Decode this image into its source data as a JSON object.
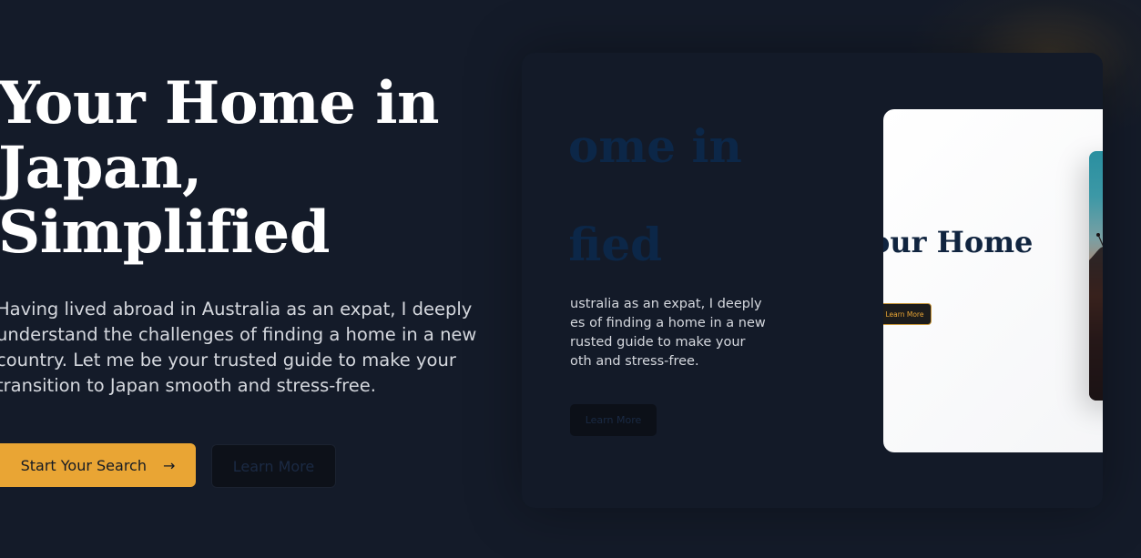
{
  "hero": {
    "title_line1": "Your Home in",
    "title_line2": "Japan,",
    "title_line3": "Simplified",
    "description": "Having lived abroad in Australia as an expat, I deeply understand the challenges of finding a home in a new country. Let me be your trusted guide to make your transition to Japan smooth and stress-free.",
    "primary_button": "Start Your Search",
    "primary_icon": "arrow-right-icon",
    "secondary_button": "Learn More"
  },
  "preview": {
    "title_line1": "ome in",
    "title_line2": "fied",
    "description": "ustralia as an expat, I deeply\nes of finding a home in a new\nrusted guide to make your\noth and stress-free.",
    "button": "Learn More",
    "card": {
      "title": "our Home",
      "button": "Learn More",
      "image": "sunset-photo"
    }
  },
  "colors": {
    "background": "#141b29",
    "accent": "#e9a534",
    "navy": "#10243f"
  }
}
